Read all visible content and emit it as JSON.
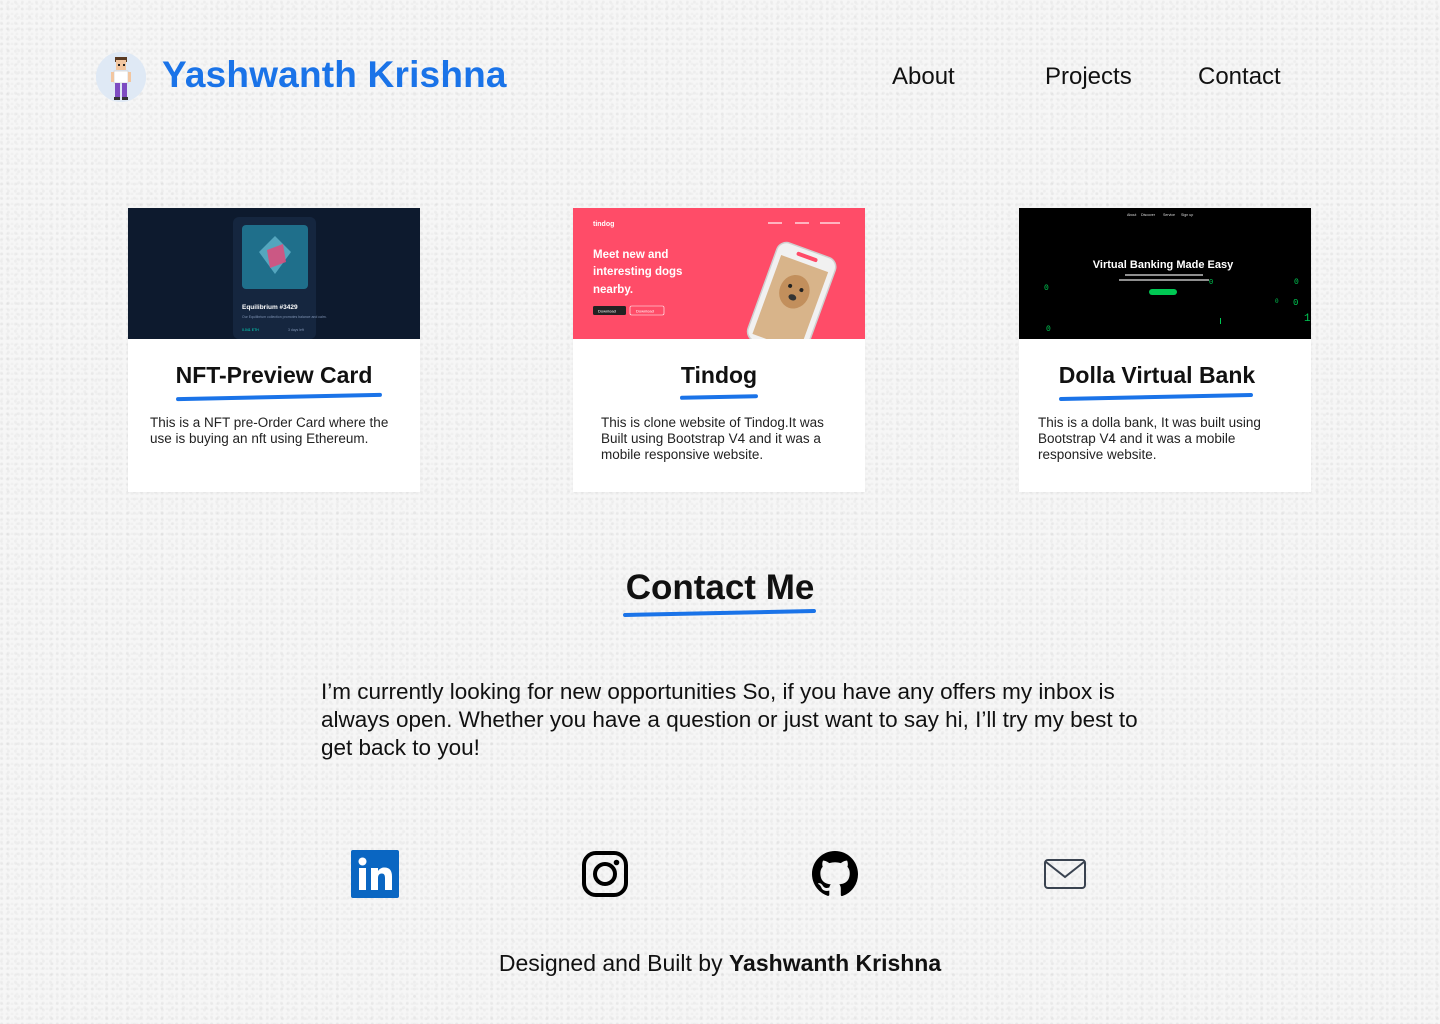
{
  "header": {
    "brand_name": "Yashwanth Krishna",
    "nav": {
      "about": "About",
      "projects": "Projects",
      "contact": "Contact"
    }
  },
  "projects": [
    {
      "title": "NFT-Preview Card",
      "description": "This is a NFT pre-Order Card where the use is buying an nft using Ethereum.",
      "thumbnail": {
        "card_title": "Equilibrium #3429",
        "card_text": "Our Equilibrium collection promotes balance and calm.",
        "price": "0.041 ETH",
        "time": "3 days left"
      }
    },
    {
      "title": "Tindog",
      "description": "This is clone website of Tindog.It was Built using Bootstrap V4 and it was a mobile responsive website.",
      "thumbnail": {
        "logo": "tindog",
        "headline_1": "Meet new and",
        "headline_2": "interesting dogs",
        "headline_3": "nearby.",
        "btn_1": "Download",
        "btn_2": "Download"
      }
    },
    {
      "title": "Dolla Virtual Bank",
      "description": "This is a dolla bank, It was built using Bootstrap V4 and it was a mobile responsive website.",
      "thumbnail": {
        "nav": [
          "About",
          "Discover",
          "Service",
          "Sign up"
        ],
        "headline": "Virtual Banking Made Easy"
      }
    }
  ],
  "contact": {
    "title": "Contact Me",
    "text": "I’m currently looking for new opportunities So, if you have any offers my inbox is always open. Whether you have a question or just want to say hi, I’ll try my best to get back to you!"
  },
  "social": [
    "linkedin-icon",
    "instagram-icon",
    "github-icon",
    "mail-icon"
  ],
  "footer": {
    "prefix": "Designed and Built by ",
    "name": "Yashwanth Krishna"
  },
  "colors": {
    "accent": "#1a73e8",
    "linkedin": "#0a66c2",
    "tindog_red": "#ff4c68",
    "nft_bg": "#0d1a2e",
    "bank_bg": "#000000",
    "bank_green": "#00c853"
  }
}
